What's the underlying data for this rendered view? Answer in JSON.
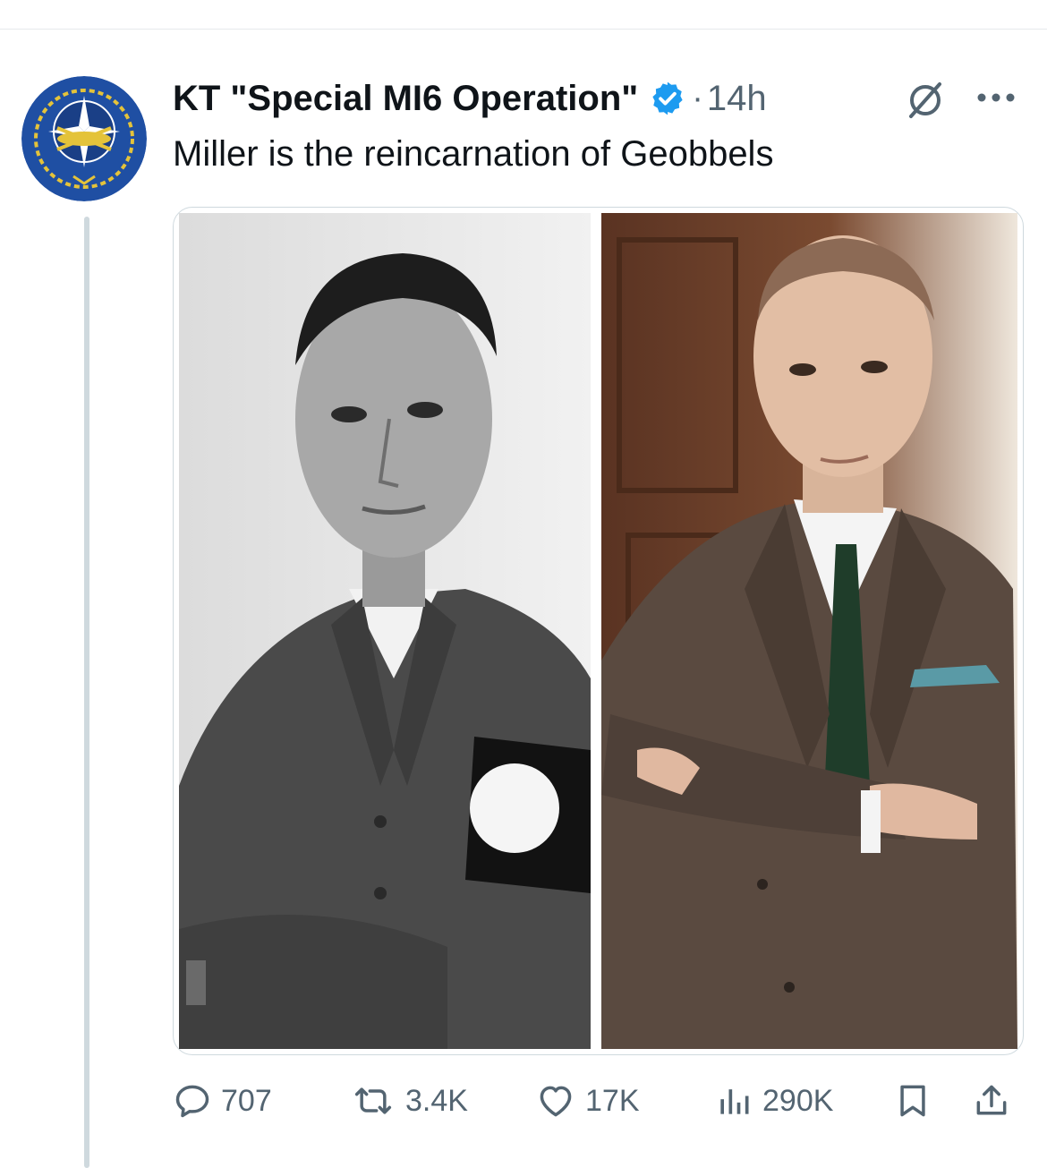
{
  "post": {
    "author_name": "KT \"Special MI6 Operation\"",
    "time_separator": "·",
    "time": "14h",
    "text": "Miller is the reincarnation of Geobbels"
  },
  "stats": {
    "replies": "707",
    "reposts": "3.4K",
    "likes": "17K",
    "views": "290K"
  },
  "icons": [
    "verified-badge-icon",
    "grok-icon",
    "more-icon",
    "reply-icon",
    "repost-icon",
    "like-icon",
    "views-icon",
    "bookmark-icon",
    "share-icon"
  ],
  "colors": {
    "verified": "#1d9bf0",
    "secondary_text": "#536471",
    "avatar_blue": "#1f4fa3",
    "avatar_gold": "#e4c33a"
  }
}
